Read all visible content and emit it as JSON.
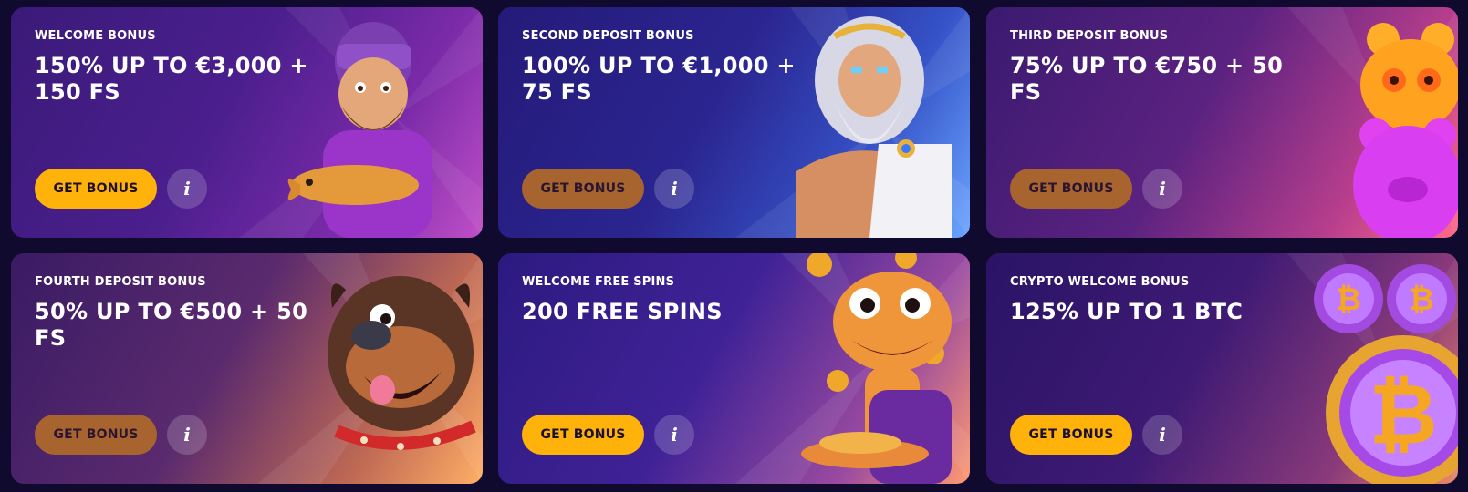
{
  "cards": [
    {
      "subtitle": "WELCOME BONUS",
      "title": "150% UP TO €3,000 + 150 FS",
      "button": "GET BONUS",
      "info": "i",
      "illustration": "fisherman-icon"
    },
    {
      "subtitle": "SECOND DEPOSIT BONUS",
      "title": "100% UP TO €1,000 + 75 FS",
      "button": "GET BONUS",
      "info": "i",
      "illustration": "zeus-icon"
    },
    {
      "subtitle": "THIRD DEPOSIT BONUS",
      "title": "75% UP TO €750 + 50 FS",
      "button": "GET BONUS",
      "info": "i",
      "illustration": "gummy-bears-icon"
    },
    {
      "subtitle": "FOURTH DEPOSIT BONUS",
      "title": "50% UP TO €500 + 50 FS",
      "button": "GET BONUS",
      "info": "i",
      "illustration": "bulldog-icon"
    },
    {
      "subtitle": "WELCOME FREE SPINS",
      "title": "200 FREE SPINS",
      "button": "GET BONUS",
      "info": "i",
      "illustration": "lizard-with-coins-icon"
    },
    {
      "subtitle": "CRYPTO WELCOME BONUS",
      "title": "125% UP TO 1 BTC",
      "button": "GET BONUS",
      "info": "i",
      "illustration": "bitcoin-coins-icon"
    }
  ],
  "colors": {
    "button_gold": "#ffb20a",
    "button_muted": "#a8642f",
    "page_bg": "#0f0a2e"
  }
}
